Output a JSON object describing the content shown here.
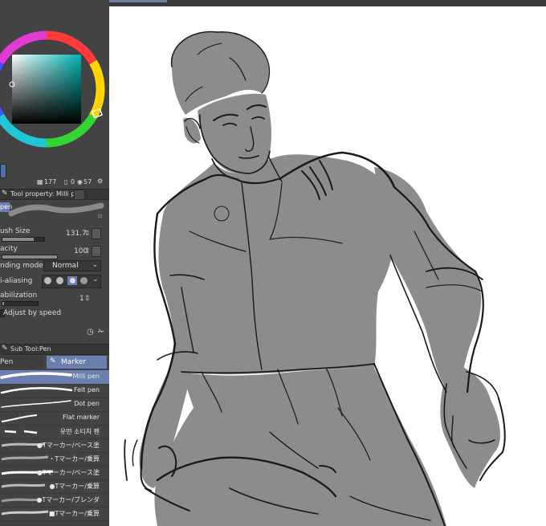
{
  "color_panel": {
    "stats": {
      "layers": "177",
      "selected": "0",
      "count": "57"
    }
  },
  "tool_property": {
    "title": "Tool property: Milli pen",
    "tab": "pen",
    "brush_size": {
      "label": "ush Size",
      "value": "131.7",
      "fraction": 0.75
    },
    "opacity": {
      "label": "acity",
      "value": "100",
      "fraction": 1.0
    },
    "blending": {
      "label": "nding mode",
      "value": "Normal"
    },
    "antialiasing": {
      "label": "i-aliasing"
    },
    "stabilization": {
      "label": "abilization",
      "value": "1"
    },
    "adjust_speed": {
      "label": "Adjust by speed"
    }
  },
  "sub_tool": {
    "title": "Sub Tool:Pen",
    "tabs": [
      "Pen",
      "Marker"
    ],
    "brushes": [
      {
        "name": "Milli pen",
        "selected": true
      },
      {
        "name": "Felt pen",
        "selected": false
      },
      {
        "name": "Dot pen",
        "selected": false
      },
      {
        "name": "Flat marker",
        "selected": false
      },
      {
        "name": "유떤 소티치 펜",
        "selected": false
      },
      {
        "name": "●Tマーカー/ベース塗",
        "selected": false
      },
      {
        "name": "・Tマーカー/乗算",
        "selected": false
      },
      {
        "name": "●Tマーカー/ベース塗",
        "selected": false
      },
      {
        "name": "●Tマーカー/乗算",
        "selected": false
      },
      {
        "name": "●Tマーカー/ブレンダ",
        "selected": false
      },
      {
        "name": "■Tマーカー/乗算",
        "selected": false
      }
    ]
  },
  "colors": {
    "panel_bg": "#434343",
    "accent": "#6a7fb0",
    "canvas_bg": "#ffffff",
    "sketch_fill": "#8c8c8c",
    "line": "#1a1a1a"
  }
}
